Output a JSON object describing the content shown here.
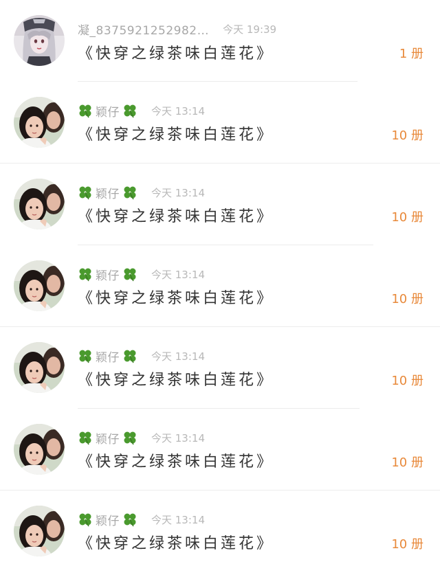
{
  "colors": {
    "name": "#a8a8a8",
    "time": "#b8b8b8",
    "title": "#333333",
    "count": "#e8893a",
    "clover": "#4a9a2e"
  },
  "items": [
    {
      "name": "凝_8375921252982…",
      "time": "今天 19:39",
      "title": "《快穿之绿茶味白莲花》",
      "count": "1 册",
      "avatar": "anime-girl-avatar",
      "clover": false
    },
    {
      "name": "颖仔",
      "time": "今天 13:14",
      "title": "《快穿之绿茶味白莲花》",
      "count": "10 册",
      "avatar": "photo-two-girls-avatar",
      "clover": true
    },
    {
      "name": "颖仔",
      "time": "今天 13:14",
      "title": "《快穿之绿茶味白莲花》",
      "count": "10 册",
      "avatar": "photo-two-girls-avatar",
      "clover": true
    },
    {
      "name": "颖仔",
      "time": "今天 13:14",
      "title": "《快穿之绿茶味白莲花》",
      "count": "10 册",
      "avatar": "photo-two-girls-avatar",
      "clover": true
    },
    {
      "name": "颖仔",
      "time": "今天 13:14",
      "title": "《快穿之绿茶味白莲花》",
      "count": "10 册",
      "avatar": "photo-two-girls-avatar",
      "clover": true
    },
    {
      "name": "颖仔",
      "time": "今天 13:14",
      "title": "《快穿之绿茶味白莲花》",
      "count": "10 册",
      "avatar": "photo-two-girls-avatar",
      "clover": true
    },
    {
      "name": "颖仔",
      "time": "今天 13:14",
      "title": "《快穿之绿茶味白莲花》",
      "count": "10 册",
      "avatar": "photo-two-girls-avatar",
      "clover": true
    }
  ]
}
